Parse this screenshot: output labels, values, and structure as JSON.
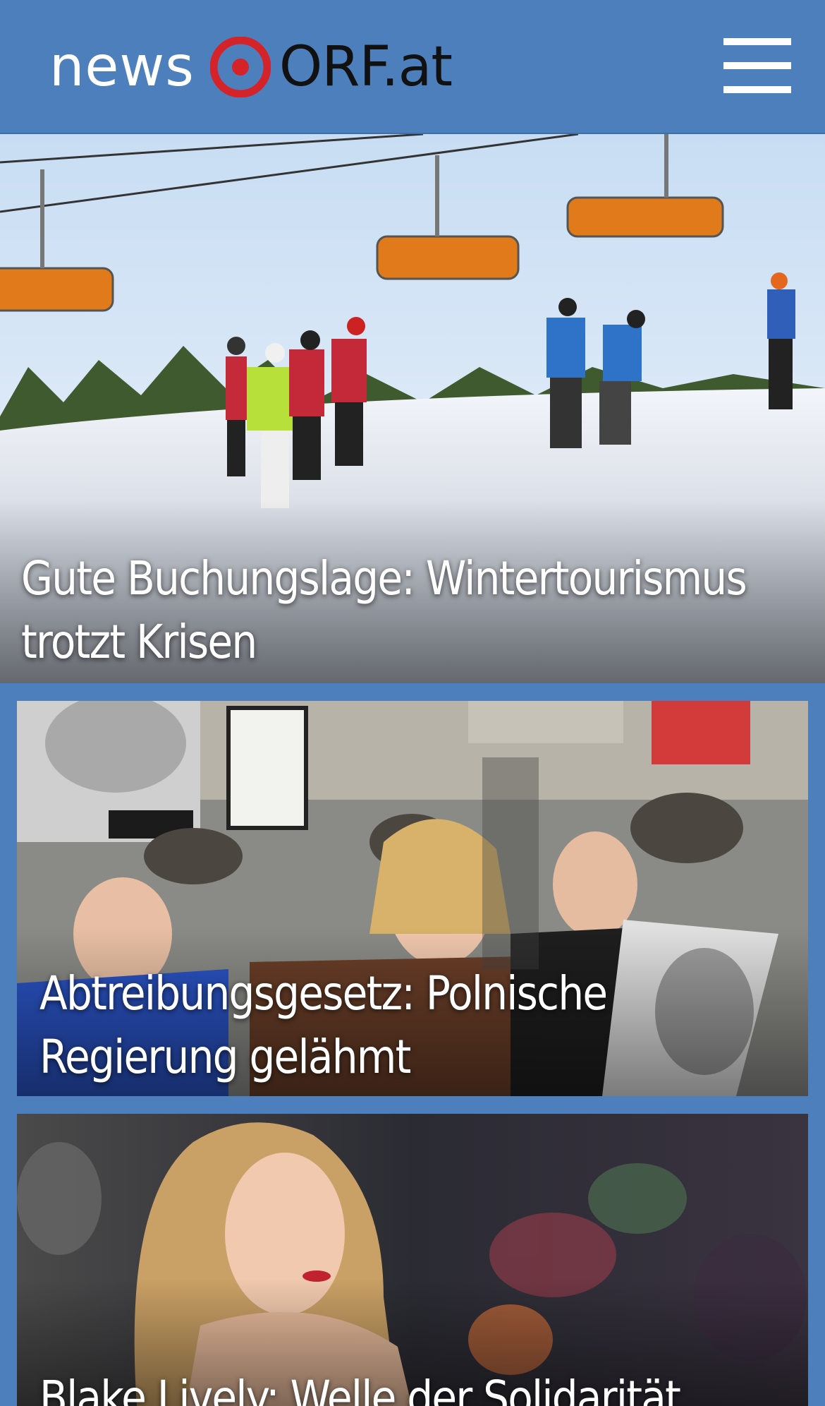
{
  "header": {
    "logo_news": "news",
    "logo_orf": "ORF.at",
    "menu_icon": "hamburger-menu-icon"
  },
  "colors": {
    "header_bg": "#4d7fbd",
    "logo_red": "#d5232a"
  },
  "stories": [
    {
      "headline_line1": "Gute Buchungslage: Wintertourismus",
      "headline_line2": "trotzt Krisen",
      "image": "ski-resort-chairlift-photo"
    },
    {
      "headline_line1": "Abtreibungsgesetz: Polnische",
      "headline_line2": "Regierung gelähmt",
      "image": "protest-crowd-photo"
    },
    {
      "headline_line1": "Blake Lively: Welle der Solidarität",
      "image": "blake-lively-portrait-photo"
    }
  ]
}
